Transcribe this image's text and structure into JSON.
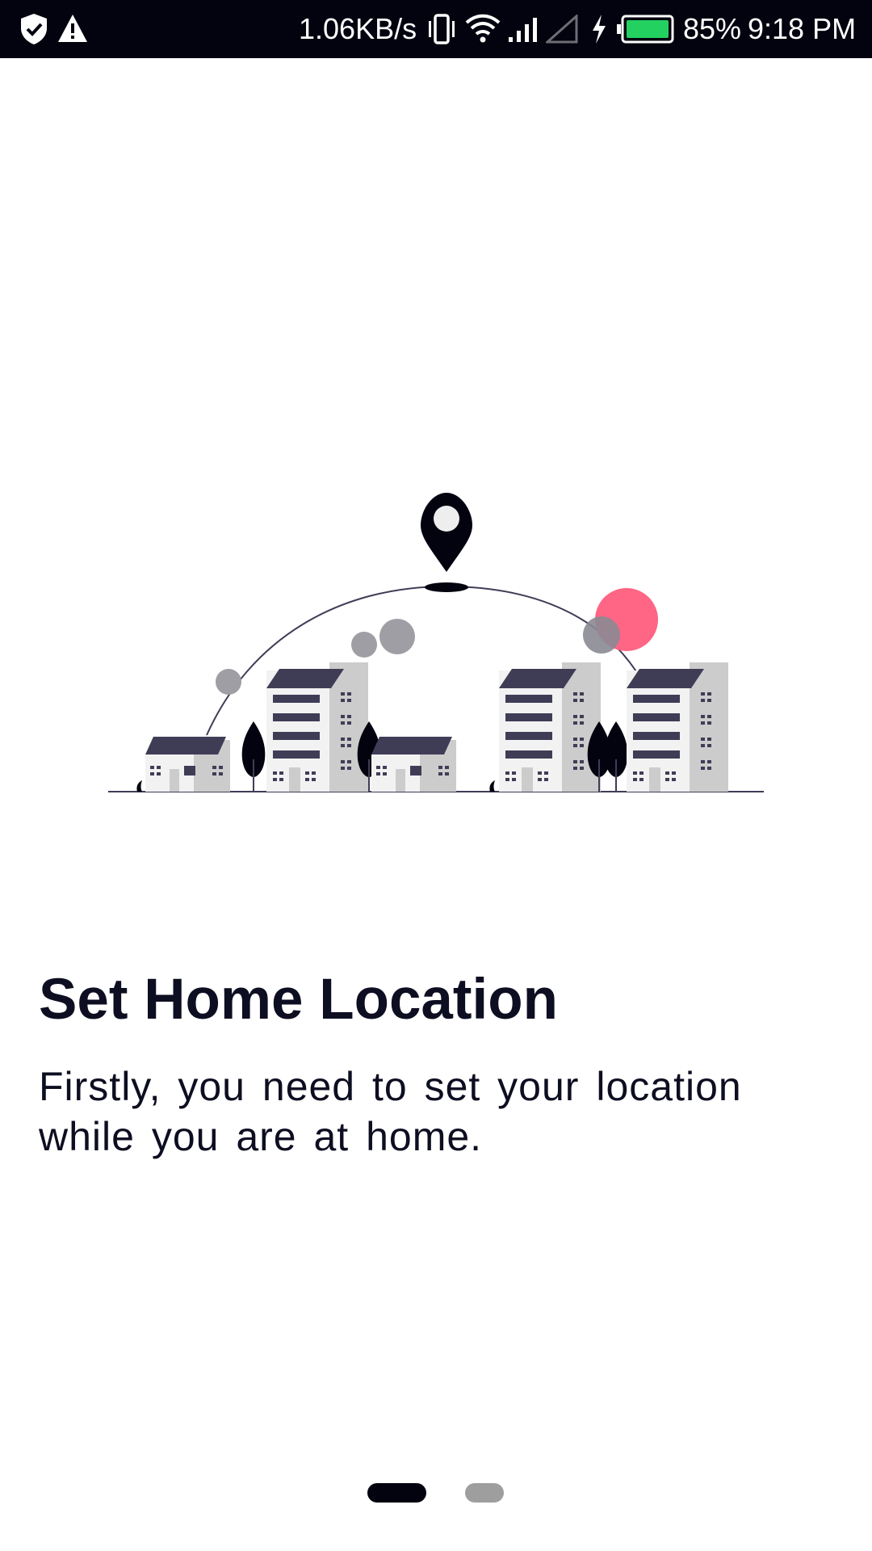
{
  "status_bar": {
    "net_speed": "1.06KB/s",
    "battery_percent": "85%",
    "time": "9:18 PM",
    "icons": [
      "shield-check-icon",
      "alert-icon",
      "vibrate-icon",
      "wifi-icon",
      "signal-icon",
      "no-signal-icon",
      "charging-icon",
      "battery-icon"
    ],
    "battery_level": 0.85
  },
  "illustration": {
    "icons": [
      "location-pin-icon",
      "house-icon",
      "apartment-building-icon",
      "tree-icon"
    ],
    "colors": {
      "dark": "#03030f",
      "roof": "#3f3d56",
      "wall_light": "#f2f2f2",
      "wall_shade": "#cccccc",
      "accent_pink": "#ff6584",
      "bubble_grey": "#9e9ea4"
    }
  },
  "onboarding": {
    "title": "Set Home Location",
    "description": "Firstly, you need to set your location while you are at home."
  },
  "pager": {
    "page_count": 2,
    "current_page": 1,
    "active_color": "#03030f",
    "inactive_color": "#9e9e9e"
  }
}
